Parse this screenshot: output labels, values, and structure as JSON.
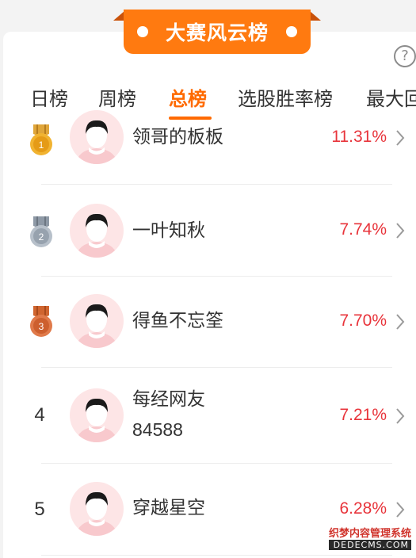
{
  "banner": {
    "title": "大赛风云榜"
  },
  "help": {
    "symbol": "?"
  },
  "tabs": [
    {
      "label": "日榜",
      "active": false
    },
    {
      "label": "周榜",
      "active": false
    },
    {
      "label": "总榜",
      "active": true
    },
    {
      "label": "选股胜率榜",
      "active": false
    },
    {
      "label": "最大回",
      "active": false
    }
  ],
  "rankings": [
    {
      "rank": "1",
      "medal": "gold",
      "name": "领哥的板板",
      "rate": "11.31%"
    },
    {
      "rank": "2",
      "medal": "silver",
      "name": "一叶知秋",
      "rate": "7.74%"
    },
    {
      "rank": "3",
      "medal": "bronze",
      "name": "得鱼不忘筌",
      "rate": "7.70%"
    },
    {
      "rank": "4",
      "medal": "",
      "name_line1": "每经网友",
      "name_line2": "84588",
      "rate": "7.21%"
    },
    {
      "rank": "5",
      "medal": "",
      "name": "穿越星空",
      "rate": "6.28%"
    }
  ],
  "watermark": {
    "line1": "织梦内容管理系统",
    "line2": "DEDECMS.COM"
  },
  "colors": {
    "accent": "#ff6a00",
    "banner": "#ff7a10",
    "rate": "#e8343b"
  }
}
